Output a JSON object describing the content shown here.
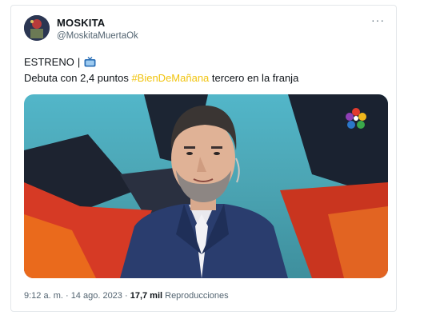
{
  "tweet": {
    "display_name": "MOSKITA",
    "handle": "@MoskitaMuertaOk",
    "more_label": "···",
    "line1": "ESTRENO",
    "line1_sep": "|",
    "line2_before": "Debuta con 2,4 puntos ",
    "hashtag": "#BienDeMañana",
    "line2_after": " tercero en la franja",
    "time": "9:12 a. m. · 14 ago. 2023 · ",
    "views_count": "17,7 mil",
    "views_label": " Reproducciones",
    "tv_icon": "television-icon",
    "hashtag_color": "#f1c40f"
  }
}
